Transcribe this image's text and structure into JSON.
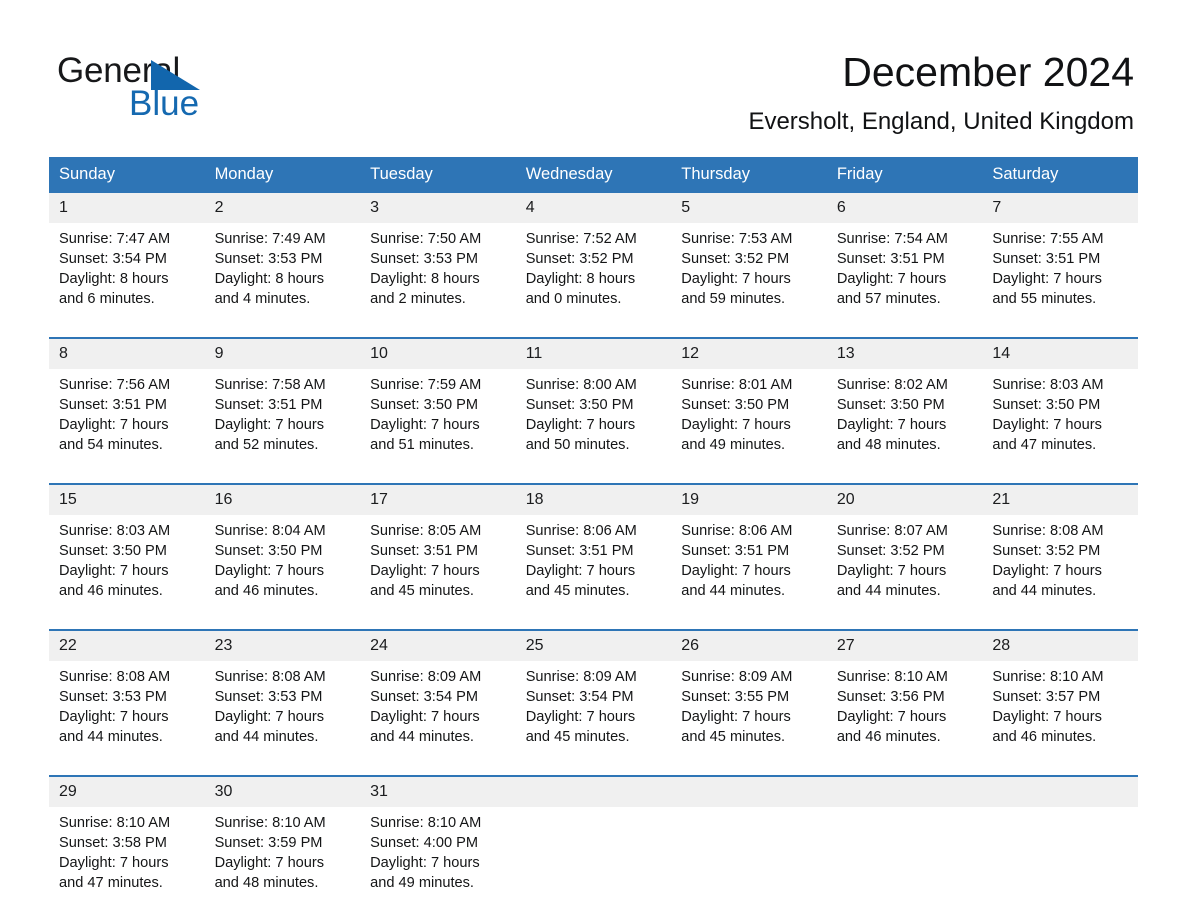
{
  "brand": {
    "name_part1": "General",
    "name_part2": "Blue",
    "triangle_icon": "triangle-icon",
    "color_dark": "#17181a",
    "color_blue": "#1569b0"
  },
  "header": {
    "title": "December 2024",
    "subtitle": "Eversholt, England, United Kingdom"
  },
  "theme": {
    "header_blue": "#2e75b6",
    "daynum_band": "#f0f0f0",
    "text": "#141516"
  },
  "weekdays": [
    "Sunday",
    "Monday",
    "Tuesday",
    "Wednesday",
    "Thursday",
    "Friday",
    "Saturday"
  ],
  "weeks": [
    {
      "days": [
        {
          "num": "1",
          "sunrise": "Sunrise: 7:47 AM",
          "sunset": "Sunset: 3:54 PM",
          "daylight_1": "Daylight: 8 hours",
          "daylight_2": "and 6 minutes."
        },
        {
          "num": "2",
          "sunrise": "Sunrise: 7:49 AM",
          "sunset": "Sunset: 3:53 PM",
          "daylight_1": "Daylight: 8 hours",
          "daylight_2": "and 4 minutes."
        },
        {
          "num": "3",
          "sunrise": "Sunrise: 7:50 AM",
          "sunset": "Sunset: 3:53 PM",
          "daylight_1": "Daylight: 8 hours",
          "daylight_2": "and 2 minutes."
        },
        {
          "num": "4",
          "sunrise": "Sunrise: 7:52 AM",
          "sunset": "Sunset: 3:52 PM",
          "daylight_1": "Daylight: 8 hours",
          "daylight_2": "and 0 minutes."
        },
        {
          "num": "5",
          "sunrise": "Sunrise: 7:53 AM",
          "sunset": "Sunset: 3:52 PM",
          "daylight_1": "Daylight: 7 hours",
          "daylight_2": "and 59 minutes."
        },
        {
          "num": "6",
          "sunrise": "Sunrise: 7:54 AM",
          "sunset": "Sunset: 3:51 PM",
          "daylight_1": "Daylight: 7 hours",
          "daylight_2": "and 57 minutes."
        },
        {
          "num": "7",
          "sunrise": "Sunrise: 7:55 AM",
          "sunset": "Sunset: 3:51 PM",
          "daylight_1": "Daylight: 7 hours",
          "daylight_2": "and 55 minutes."
        }
      ]
    },
    {
      "days": [
        {
          "num": "8",
          "sunrise": "Sunrise: 7:56 AM",
          "sunset": "Sunset: 3:51 PM",
          "daylight_1": "Daylight: 7 hours",
          "daylight_2": "and 54 minutes."
        },
        {
          "num": "9",
          "sunrise": "Sunrise: 7:58 AM",
          "sunset": "Sunset: 3:51 PM",
          "daylight_1": "Daylight: 7 hours",
          "daylight_2": "and 52 minutes."
        },
        {
          "num": "10",
          "sunrise": "Sunrise: 7:59 AM",
          "sunset": "Sunset: 3:50 PM",
          "daylight_1": "Daylight: 7 hours",
          "daylight_2": "and 51 minutes."
        },
        {
          "num": "11",
          "sunrise": "Sunrise: 8:00 AM",
          "sunset": "Sunset: 3:50 PM",
          "daylight_1": "Daylight: 7 hours",
          "daylight_2": "and 50 minutes."
        },
        {
          "num": "12",
          "sunrise": "Sunrise: 8:01 AM",
          "sunset": "Sunset: 3:50 PM",
          "daylight_1": "Daylight: 7 hours",
          "daylight_2": "and 49 minutes."
        },
        {
          "num": "13",
          "sunrise": "Sunrise: 8:02 AM",
          "sunset": "Sunset: 3:50 PM",
          "daylight_1": "Daylight: 7 hours",
          "daylight_2": "and 48 minutes."
        },
        {
          "num": "14",
          "sunrise": "Sunrise: 8:03 AM",
          "sunset": "Sunset: 3:50 PM",
          "daylight_1": "Daylight: 7 hours",
          "daylight_2": "and 47 minutes."
        }
      ]
    },
    {
      "days": [
        {
          "num": "15",
          "sunrise": "Sunrise: 8:03 AM",
          "sunset": "Sunset: 3:50 PM",
          "daylight_1": "Daylight: 7 hours",
          "daylight_2": "and 46 minutes."
        },
        {
          "num": "16",
          "sunrise": "Sunrise: 8:04 AM",
          "sunset": "Sunset: 3:50 PM",
          "daylight_1": "Daylight: 7 hours",
          "daylight_2": "and 46 minutes."
        },
        {
          "num": "17",
          "sunrise": "Sunrise: 8:05 AM",
          "sunset": "Sunset: 3:51 PM",
          "daylight_1": "Daylight: 7 hours",
          "daylight_2": "and 45 minutes."
        },
        {
          "num": "18",
          "sunrise": "Sunrise: 8:06 AM",
          "sunset": "Sunset: 3:51 PM",
          "daylight_1": "Daylight: 7 hours",
          "daylight_2": "and 45 minutes."
        },
        {
          "num": "19",
          "sunrise": "Sunrise: 8:06 AM",
          "sunset": "Sunset: 3:51 PM",
          "daylight_1": "Daylight: 7 hours",
          "daylight_2": "and 44 minutes."
        },
        {
          "num": "20",
          "sunrise": "Sunrise: 8:07 AM",
          "sunset": "Sunset: 3:52 PM",
          "daylight_1": "Daylight: 7 hours",
          "daylight_2": "and 44 minutes."
        },
        {
          "num": "21",
          "sunrise": "Sunrise: 8:08 AM",
          "sunset": "Sunset: 3:52 PM",
          "daylight_1": "Daylight: 7 hours",
          "daylight_2": "and 44 minutes."
        }
      ]
    },
    {
      "days": [
        {
          "num": "22",
          "sunrise": "Sunrise: 8:08 AM",
          "sunset": "Sunset: 3:53 PM",
          "daylight_1": "Daylight: 7 hours",
          "daylight_2": "and 44 minutes."
        },
        {
          "num": "23",
          "sunrise": "Sunrise: 8:08 AM",
          "sunset": "Sunset: 3:53 PM",
          "daylight_1": "Daylight: 7 hours",
          "daylight_2": "and 44 minutes."
        },
        {
          "num": "24",
          "sunrise": "Sunrise: 8:09 AM",
          "sunset": "Sunset: 3:54 PM",
          "daylight_1": "Daylight: 7 hours",
          "daylight_2": "and 44 minutes."
        },
        {
          "num": "25",
          "sunrise": "Sunrise: 8:09 AM",
          "sunset": "Sunset: 3:54 PM",
          "daylight_1": "Daylight: 7 hours",
          "daylight_2": "and 45 minutes."
        },
        {
          "num": "26",
          "sunrise": "Sunrise: 8:09 AM",
          "sunset": "Sunset: 3:55 PM",
          "daylight_1": "Daylight: 7 hours",
          "daylight_2": "and 45 minutes."
        },
        {
          "num": "27",
          "sunrise": "Sunrise: 8:10 AM",
          "sunset": "Sunset: 3:56 PM",
          "daylight_1": "Daylight: 7 hours",
          "daylight_2": "and 46 minutes."
        },
        {
          "num": "28",
          "sunrise": "Sunrise: 8:10 AM",
          "sunset": "Sunset: 3:57 PM",
          "daylight_1": "Daylight: 7 hours",
          "daylight_2": "and 46 minutes."
        }
      ]
    },
    {
      "days": [
        {
          "num": "29",
          "sunrise": "Sunrise: 8:10 AM",
          "sunset": "Sunset: 3:58 PM",
          "daylight_1": "Daylight: 7 hours",
          "daylight_2": "and 47 minutes."
        },
        {
          "num": "30",
          "sunrise": "Sunrise: 8:10 AM",
          "sunset": "Sunset: 3:59 PM",
          "daylight_1": "Daylight: 7 hours",
          "daylight_2": "and 48 minutes."
        },
        {
          "num": "31",
          "sunrise": "Sunrise: 8:10 AM",
          "sunset": "Sunset: 4:00 PM",
          "daylight_1": "Daylight: 7 hours",
          "daylight_2": "and 49 minutes."
        },
        {
          "num": "",
          "sunrise": "",
          "sunset": "",
          "daylight_1": "",
          "daylight_2": ""
        },
        {
          "num": "",
          "sunrise": "",
          "sunset": "",
          "daylight_1": "",
          "daylight_2": ""
        },
        {
          "num": "",
          "sunrise": "",
          "sunset": "",
          "daylight_1": "",
          "daylight_2": ""
        },
        {
          "num": "",
          "sunrise": "",
          "sunset": "",
          "daylight_1": "",
          "daylight_2": ""
        }
      ]
    }
  ]
}
